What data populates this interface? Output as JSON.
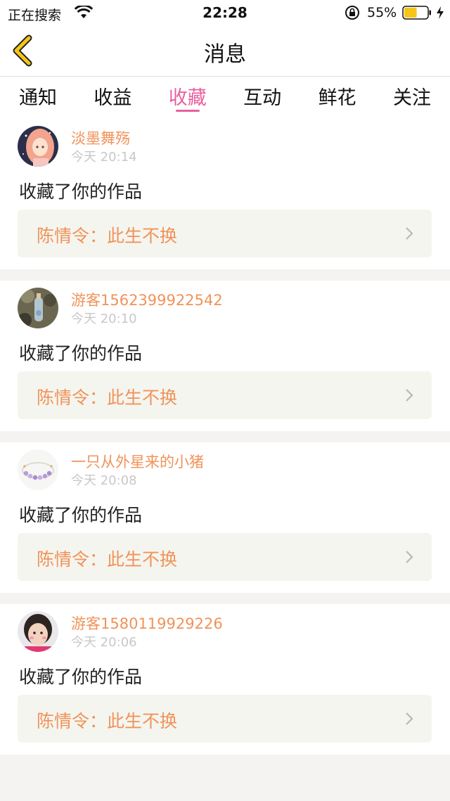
{
  "status_bar": {
    "carrier": "正在搜索",
    "time": "22:28",
    "battery_percent": "55%",
    "battery_level": 0.55,
    "battery_color": "#f5c518",
    "charging": true
  },
  "nav": {
    "title": "消息",
    "back_icon": "chevron-left-icon",
    "back_color": "#f5c518"
  },
  "tabs": [
    {
      "label": "通知",
      "active": false
    },
    {
      "label": "收益",
      "active": false
    },
    {
      "label": "收藏",
      "active": true
    },
    {
      "label": "互动",
      "active": false
    },
    {
      "label": "鲜花",
      "active": false
    },
    {
      "label": "关注",
      "active": false
    }
  ],
  "colors": {
    "accent_pink": "#e8609f",
    "username_orange": "#f0935a",
    "timestamp_gray": "#c8c8c8"
  },
  "messages": [
    {
      "username": "淡墨舞殇",
      "time": "今天 20:14",
      "action": "收藏了你的作品",
      "work_title": "陈情令：此生不换",
      "avatar": "anime-girl-avatar"
    },
    {
      "username": "游客1562399922542",
      "time": "今天 20:10",
      "action": "收藏了你的作品",
      "work_title": "陈情令：此生不换",
      "avatar": "bottle-photo-avatar"
    },
    {
      "username": "一只从外星来的小猪",
      "time": "今天 20:08",
      "action": "收藏了你的作品",
      "work_title": "陈情令：此生不换",
      "avatar": "bracelet-photo-avatar"
    },
    {
      "username": "游客1580119929226",
      "time": "今天 20:06",
      "action": "收藏了你的作品",
      "work_title": "陈情令：此生不换",
      "avatar": "child-photo-avatar"
    }
  ]
}
